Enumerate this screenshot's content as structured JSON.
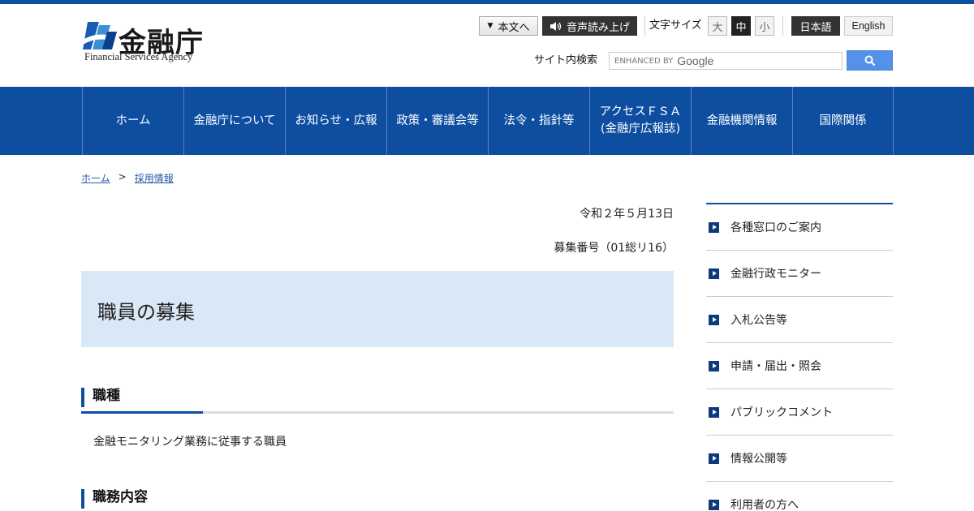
{
  "brand": {
    "name_ja": "金融庁",
    "name_en": "Financial Services Agency",
    "color": "#0d4ea1"
  },
  "utility": {
    "skip_label": "本文へ",
    "voice_label": "音声読み上げ",
    "font_size_label": "文字サイズ",
    "font_sizes": [
      "大",
      "中",
      "小"
    ],
    "font_size_active": "中",
    "lang_ja": "日本語",
    "lang_en": "English"
  },
  "search": {
    "label": "サイト内検索",
    "placeholder_prefix": "ENHANCED BY",
    "placeholder_brand": "Google",
    "button_icon": "search-icon"
  },
  "gnav": [
    "ホーム",
    "金融庁について",
    "お知らせ・広報",
    "政策・審議会等",
    "法令・指針等",
    "アクセスＦＳＡ\n(金融庁広報誌)",
    "金融機関情報",
    "国際関係"
  ],
  "breadcrumb": {
    "home": "ホーム",
    "separator": ">",
    "current": "採用情報"
  },
  "main": {
    "date": "令和２年５月13日",
    "recruit_no": "募集番号（01総リ16）",
    "title": "職員の募集",
    "sections": [
      {
        "heading": "職種",
        "text": "金融モニタリング業務に従事する職員"
      },
      {
        "heading": "職務内容"
      }
    ]
  },
  "side_nav": [
    "各種窓口のご案内",
    "金融行政モニター",
    "入札公告等",
    "申請・届出・照会",
    "パブリックコメント",
    "情報公開等",
    "利用者の方へ"
  ]
}
